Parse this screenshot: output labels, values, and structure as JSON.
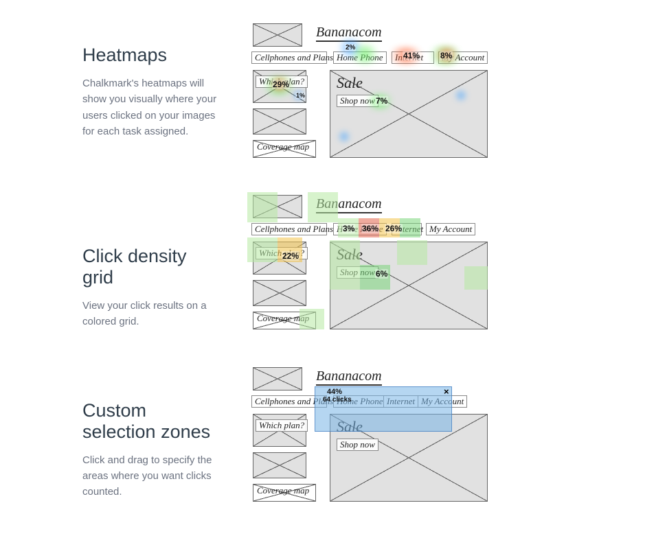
{
  "sections": {
    "heatmaps": {
      "title": "Heatmaps",
      "desc": "Chalkmark's heatmaps will show you visually where your users clicked on your images for each task assigned."
    },
    "density": {
      "title": "Click density grid",
      "desc": "View your click results on a colored grid."
    },
    "zones": {
      "title": "Custom selection zones",
      "desc": "Click and drag to specify the areas where you want clicks counted."
    }
  },
  "mockup": {
    "brand": "Bananacom",
    "nav": {
      "cellphones": "Cellphones and Plans",
      "homephone": "Home Phone",
      "internet": "Internet",
      "myaccount": "My Account"
    },
    "sidebar": {
      "which_plan": "Which plan?",
      "coverage": "Coverage map"
    },
    "main": {
      "sale": "Sale",
      "shop_now": "Shop now"
    }
  },
  "heatmap_values": {
    "homephone_top": "2%",
    "internet": "41%",
    "myaccount": "8%",
    "which_plan": "29%",
    "which_plan_small": "1%",
    "shop_now": "7%"
  },
  "density_values": {
    "internet1": "3%",
    "internet2": "36%",
    "internet3": "26%",
    "which_plan": "22%",
    "shop_now": "6%"
  },
  "zone_values": {
    "pct": "44%",
    "clicks": "64 clicks",
    "close": "×"
  }
}
